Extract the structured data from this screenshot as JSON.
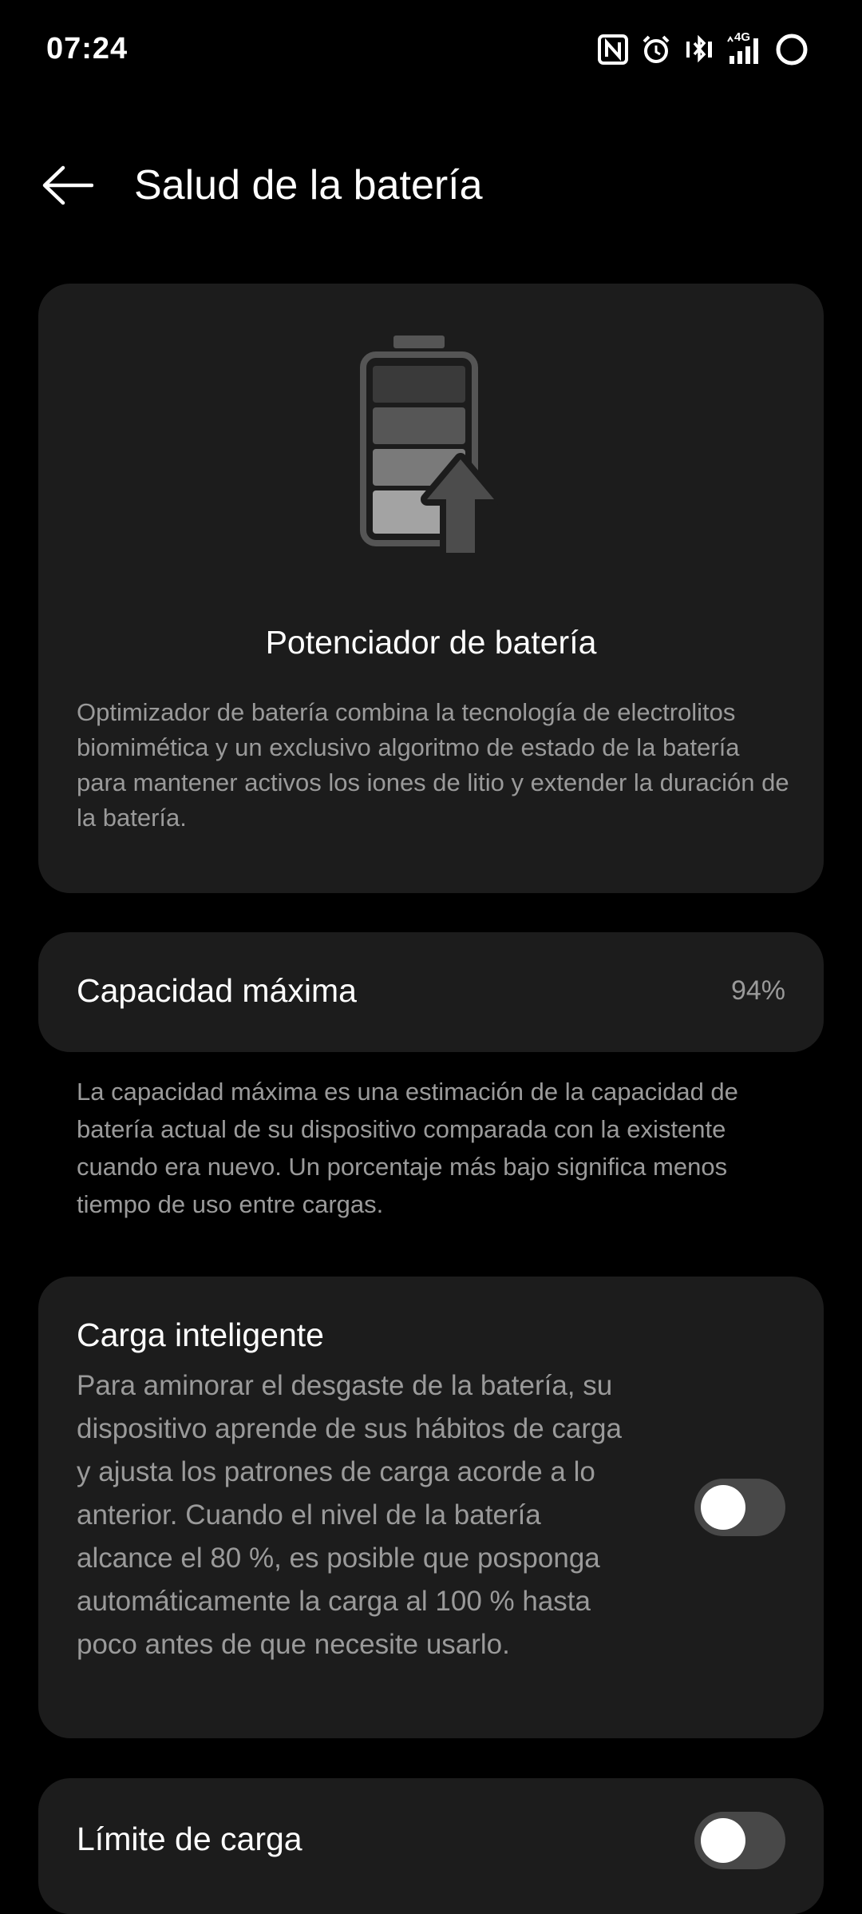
{
  "status_bar": {
    "time": "07:24",
    "network_label": "4G",
    "icons": [
      "nfc-icon",
      "alarm-icon",
      "bluetooth-vibrate-icon",
      "signal-4g-icon",
      "battery-ring-icon"
    ]
  },
  "app_bar": {
    "back_icon": "arrow-left-icon",
    "title": "Salud de la batería"
  },
  "hero": {
    "icon": "battery-boost-icon",
    "title": "Potenciador de batería",
    "description": "Optimizador de batería combina la tecnología de electrolitos biomimética y un exclusivo algoritmo de estado de la batería para mantener activos los iones de litio y extender la duración de la batería."
  },
  "capacity": {
    "label": "Capacidad máxima",
    "value": "94%",
    "note": "La capacidad máxima es una estimación de la capacidad de batería actual de su dispositivo comparada con la existente cuando era nuevo. Un porcentaje más bajo significa menos tiempo de uso entre cargas."
  },
  "smart_charging": {
    "title": "Carga inteligente",
    "description": "Para aminorar el desgaste de la batería, su dispositivo aprende de sus hábitos de carga y ajusta los patrones de carga acorde a lo anterior. Cuando el nivel de la batería alcance el 80 %, es posible que posponga automáticamente la carga al 100 % hasta poco antes de que necesite usarlo.",
    "enabled": false
  },
  "charge_limit": {
    "label": "Límite de carga",
    "enabled": false
  },
  "colors": {
    "background": "#000000",
    "card": "#1c1c1c",
    "primary_text": "#ffffff",
    "secondary_text": "#9a9a9a",
    "toggle_off_track": "#484848"
  }
}
